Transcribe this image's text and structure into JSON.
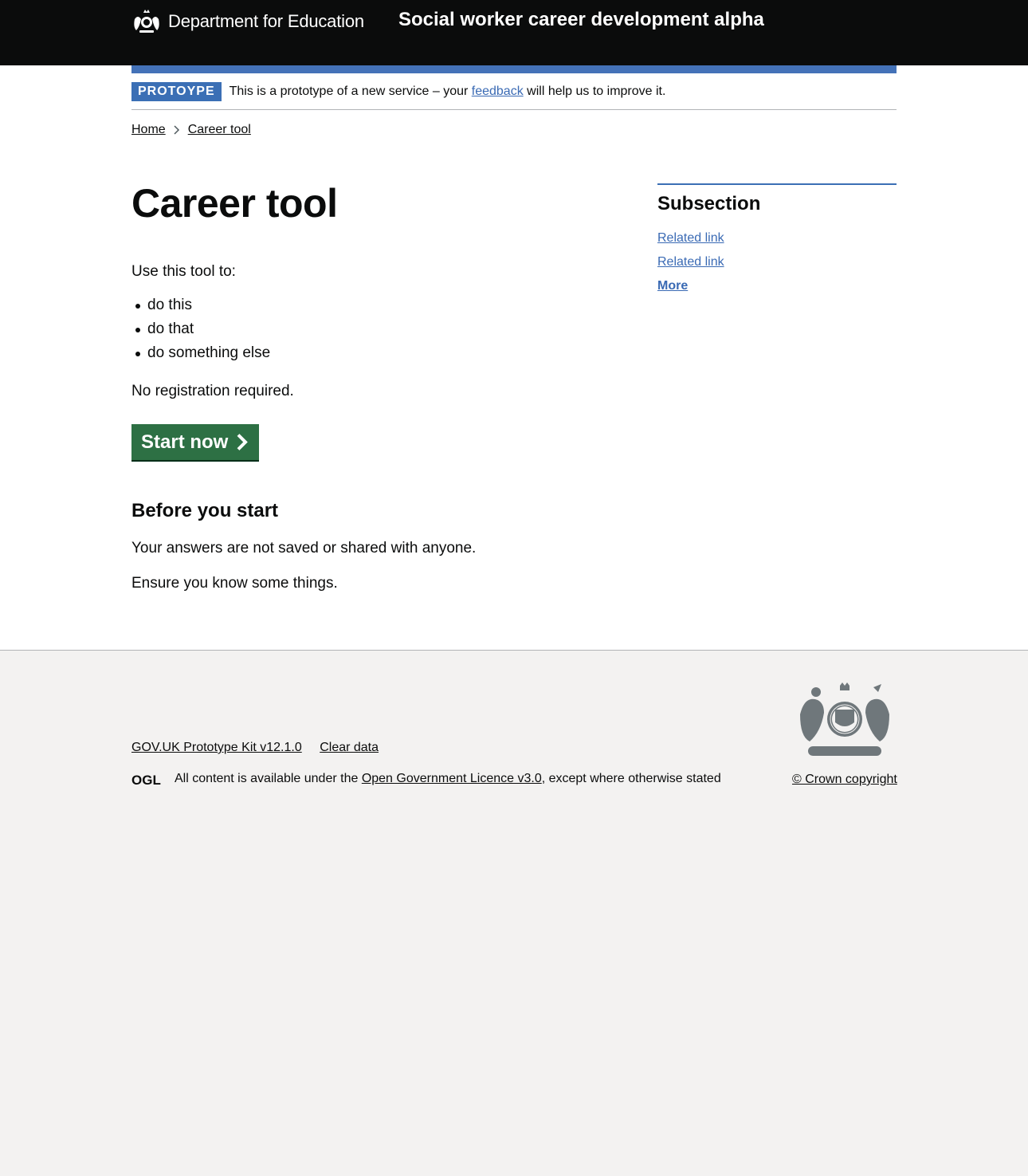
{
  "header": {
    "organisation": "Department for Education",
    "service_name": "Social worker career development alpha"
  },
  "phase_banner": {
    "tag": "PROTOYPE",
    "text_before": "This is a prototype of a new service – your ",
    "link": "feedback",
    "text_after": " will help us to improve it."
  },
  "breadcrumbs": {
    "items": [
      "Home",
      "Career tool"
    ]
  },
  "main": {
    "title": "Career tool",
    "intro": "Use this tool to:",
    "bullets": [
      "do this",
      "do that",
      "do something else"
    ],
    "registration": "No registration required.",
    "start_button": "Start now",
    "before_heading": "Before you start",
    "before_paragraphs": [
      "Your answers are not saved or shared with anyone.",
      "Ensure you know some things."
    ]
  },
  "aside": {
    "heading": "Subsection",
    "links": [
      "Related link",
      "Related link",
      "More"
    ]
  },
  "footer": {
    "links": [
      "GOV.UK Prototype Kit v12.1.0",
      "Clear data"
    ],
    "licence_before": "All content is available under the ",
    "licence_link": "Open Government Licence v3.0",
    "licence_after": ", except where otherwise stated",
    "copyright": "© Crown copyright",
    "logo_text": "OGL"
  },
  "colors": {
    "header_bg": "#0b0c0c",
    "accent_blue": "#3b6fb5",
    "start_green": "#2d7044",
    "footer_bg": "#f3f2f1"
  }
}
